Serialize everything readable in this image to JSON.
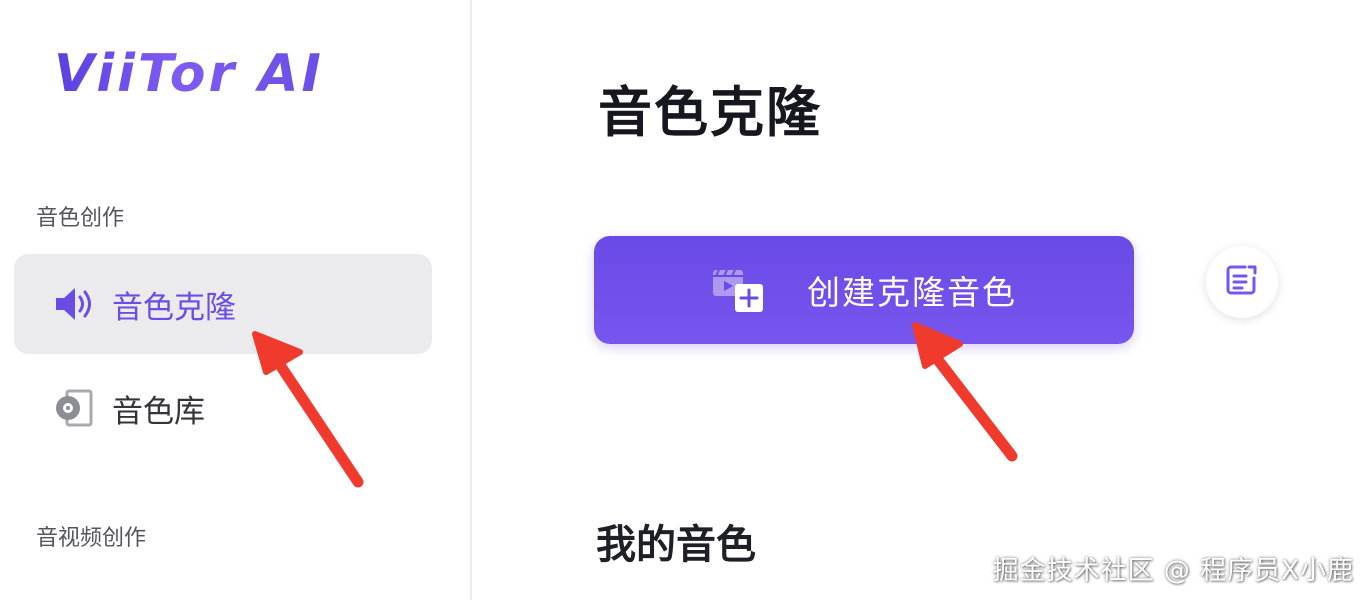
{
  "app": {
    "logo": "ViiTor AI"
  },
  "sidebar": {
    "sections": [
      {
        "label": "音色创作"
      },
      {
        "label": "音视频创作"
      }
    ],
    "items": [
      {
        "label": "音色克隆",
        "icon": "speaker-icon",
        "active": true
      },
      {
        "label": "音色库",
        "icon": "disc-icon",
        "active": false
      }
    ]
  },
  "main": {
    "title": "音色克隆",
    "create_button": {
      "label": "创建克隆音色",
      "icon": "video-add-icon"
    },
    "edit_button": {
      "icon": "edit-icon"
    },
    "my_voices_heading": "我的音色"
  },
  "watermark": "掘金技术社区 @ 程序员X小鹿",
  "colors": {
    "accent": "#6b4de6",
    "button_bg": "#6e4fea",
    "active_bg": "#ebebee",
    "annotation_arrow": "#f03a2e"
  }
}
